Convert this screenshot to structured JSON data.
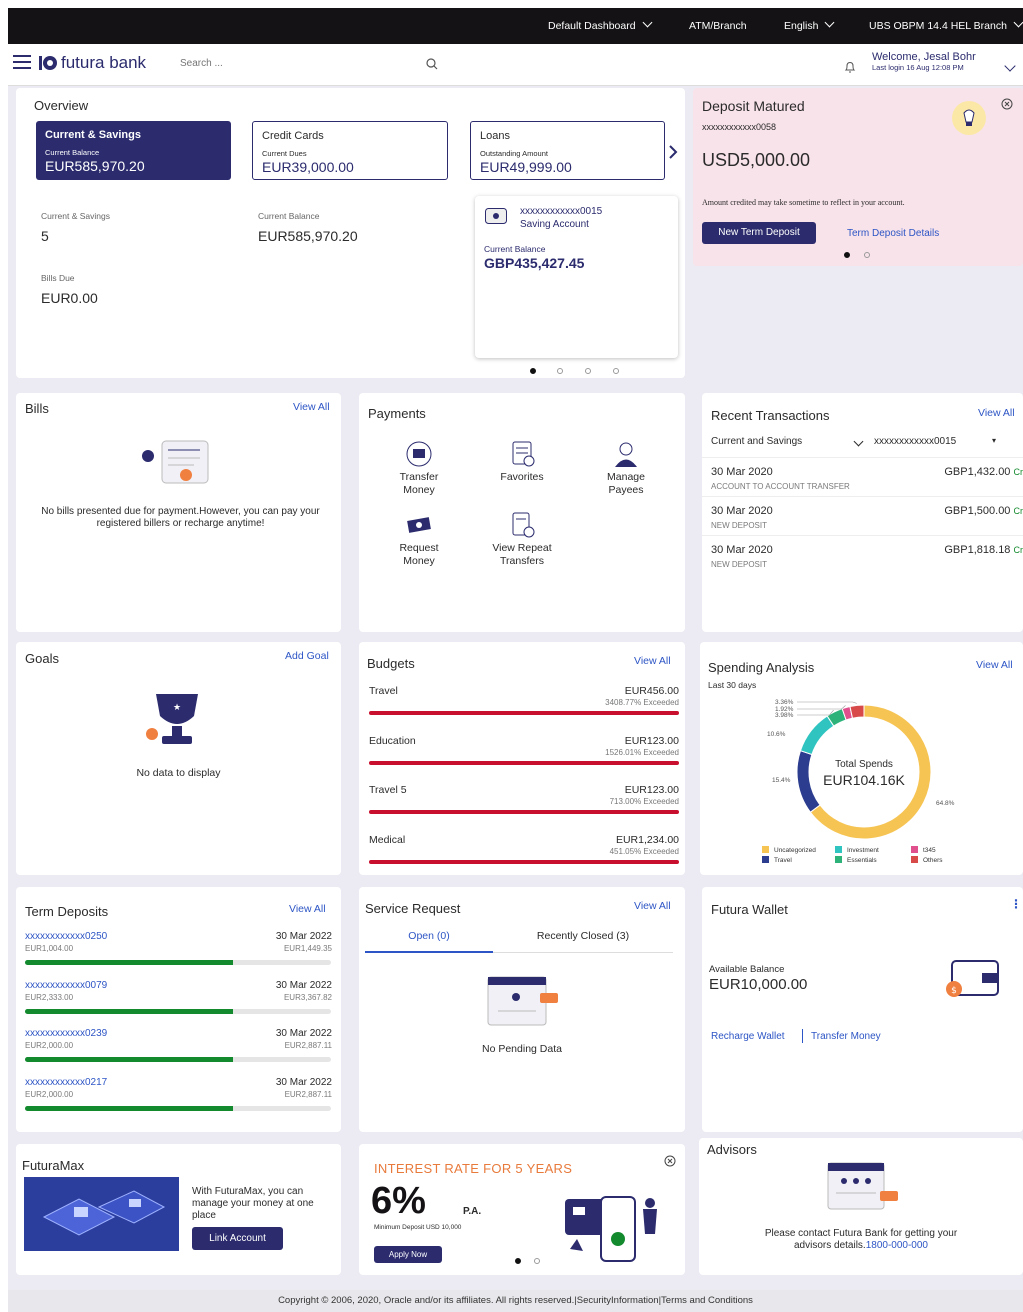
{
  "topbar": {
    "dashboard": "Default Dashboard",
    "atm": "ATM/Branch",
    "language": "English",
    "branch": "UBS OBPM 14.4 HEL Branch"
  },
  "header": {
    "brand": "futura bank",
    "search_placeholder": "Search ...",
    "welcome": "Welcome, Jesal Bohr",
    "last_login": "Last login 16 Aug 12:08 PM"
  },
  "overview": {
    "title": "Overview",
    "tiles": [
      {
        "title": "Current & Savings",
        "label": "Current Balance",
        "value": "EUR585,970.20"
      },
      {
        "title": "Credit Cards",
        "label": "Current Dues",
        "value": "EUR39,000.00"
      },
      {
        "title": "Loans",
        "label": "Outstanding Amount",
        "value": "EUR49,999.00"
      }
    ],
    "stats": [
      {
        "label": "Current & Savings",
        "value": "5"
      },
      {
        "label": "Current Balance",
        "value": "EUR585,970.20"
      },
      {
        "label": "Bills Due",
        "value": "EUR0.00"
      }
    ],
    "account": {
      "number": "xxxxxxxxxxxx0015",
      "type": "Saving Account",
      "label": "Current Balance",
      "value": "GBP435,427.45"
    }
  },
  "deposit": {
    "title": "Deposit Matured",
    "account": "xxxxxxxxxxxx0058",
    "amount": "USD5,000.00",
    "note": "Amount credited may take sometime to reflect in your account.",
    "btn": "New Term Deposit",
    "link": "Term Deposit Details"
  },
  "bills": {
    "title": "Bills",
    "view_all": "View All",
    "message": "No bills presented due for payment.However, you can pay your registered billers or recharge anytime!"
  },
  "payments": {
    "title": "Payments",
    "items": [
      {
        "label": "Transfer Money",
        "icon": "transfer-icon"
      },
      {
        "label": "Favorites",
        "icon": "favorites-icon"
      },
      {
        "label": "Manage Payees",
        "icon": "payees-icon"
      },
      {
        "label": "Request Money",
        "icon": "request-icon"
      },
      {
        "label": "View Repeat Transfers",
        "icon": "repeat-icon"
      }
    ]
  },
  "recent": {
    "title": "Recent Transactions",
    "view_all": "View All",
    "filter1": "Current and Savings",
    "filter2": "xxxxxxxxxxxx0015",
    "rows": [
      {
        "date": "30 Mar 2020",
        "amount": "GBP1,432.00",
        "cr": "Cr",
        "desc": "ACCOUNT TO ACCOUNT TRANSFER"
      },
      {
        "date": "30 Mar 2020",
        "amount": "GBP1,500.00",
        "cr": "Cr",
        "desc": "NEW DEPOSIT"
      },
      {
        "date": "30 Mar 2020",
        "amount": "GBP1,818.18",
        "cr": "Cr",
        "desc": "NEW DEPOSIT"
      }
    ]
  },
  "goals": {
    "title": "Goals",
    "add": "Add Goal",
    "empty": "No data to display"
  },
  "budgets": {
    "title": "Budgets",
    "view_all": "View All",
    "items": [
      {
        "name": "Travel",
        "amount": "EUR456.00",
        "status": "3408.77% Exceeded"
      },
      {
        "name": "Education",
        "amount": "EUR123.00",
        "status": "1526.01% Exceeded"
      },
      {
        "name": "Travel 5",
        "amount": "EUR123.00",
        "status": "713.00% Exceeded"
      },
      {
        "name": "Medical",
        "amount": "EUR1,234.00",
        "status": "451.05% Exceeded"
      }
    ]
  },
  "spending": {
    "title": "Spending Analysis",
    "view_all": "View All",
    "period": "Last 30 days",
    "center_label": "Total Spends",
    "center_value": "EUR104.16K",
    "slices": [
      {
        "name": "Uncategorized",
        "value": 64.8,
        "label": "64.8%",
        "color": "#f6c453"
      },
      {
        "name": "Travel",
        "value": 15.4,
        "label": "15.4%",
        "color": "#2c3d8f"
      },
      {
        "name": "Investment",
        "value": 10.6,
        "label": "10.6%",
        "color": "#2fc4c0"
      },
      {
        "name": "Essentials",
        "value": 3.98,
        "label": "3.98%",
        "color": "#2db37a"
      },
      {
        "name": "t345",
        "value": 1.92,
        "label": "1.92%",
        "color": "#e0508c"
      },
      {
        "name": "Others",
        "value": 3.36,
        "label": "3.36%",
        "color": "#d84a4a"
      }
    ]
  },
  "term": {
    "title": "Term Deposits",
    "view_all": "View All",
    "rows": [
      {
        "acct": "xxxxxxxxxxxx0250",
        "date": "30 Mar 2022",
        "principal": "EUR1,004.00",
        "maturity": "EUR1,449.35",
        "progress": 0.68
      },
      {
        "acct": "xxxxxxxxxxxx0079",
        "date": "30 Mar 2022",
        "principal": "EUR2,333.00",
        "maturity": "EUR3,367.82",
        "progress": 0.68
      },
      {
        "acct": "xxxxxxxxxxxx0239",
        "date": "30 Mar 2022",
        "principal": "EUR2,000.00",
        "maturity": "EUR2,887.11",
        "progress": 0.68
      },
      {
        "acct": "xxxxxxxxxxxx0217",
        "date": "30 Mar 2022",
        "principal": "EUR2,000.00",
        "maturity": "EUR2,887.11",
        "progress": 0.68
      }
    ]
  },
  "service": {
    "title": "Service Request",
    "view_all": "View All",
    "tab_open": "Open (0)",
    "tab_closed": "Recently Closed (3)",
    "empty": "No Pending Data"
  },
  "wallet": {
    "title": "Futura Wallet",
    "label": "Available Balance",
    "value": "EUR10,000.00",
    "recharge": "Recharge Wallet",
    "transfer": "Transfer Money"
  },
  "futuramax": {
    "title": "FuturaMax",
    "text": "With FuturaMax, you can manage your money at one place",
    "btn": "Link Account"
  },
  "promo": {
    "headline": "INTEREST RATE FOR 5 YEARS",
    "rate": "6%",
    "pa": "P.A.",
    "min": "Minimum Deposit USD 10,000",
    "btn": "Apply Now"
  },
  "advisors": {
    "title": "Advisors",
    "text": "Please contact Futura Bank for getting your advisors details.",
    "phone": "1800-000-000"
  },
  "footer": {
    "text": "Copyright © 2006, 2020, Oracle and/or its affiliates. All rights reserved.|SecurityInformation|Terms and Conditions"
  },
  "colors": {
    "navy": "#2b2b6e",
    "link": "#2d55c5",
    "green": "#138a2e",
    "red": "#c8102e"
  }
}
